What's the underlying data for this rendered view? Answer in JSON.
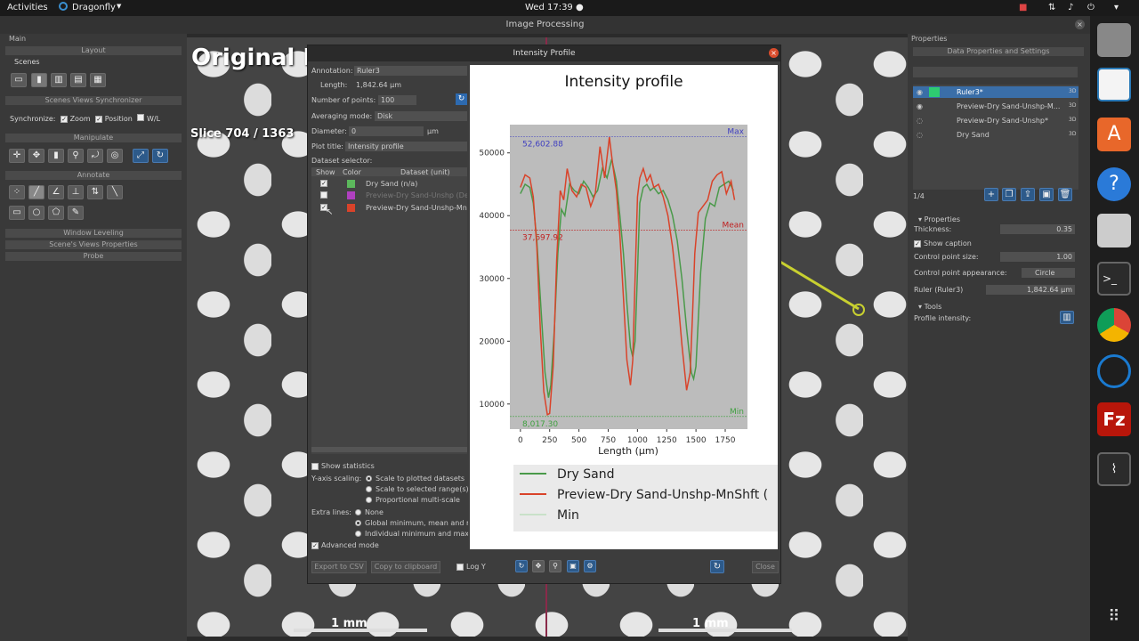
{
  "topbar": {
    "activities": "Activities",
    "app": "Dragonfly",
    "clock": "Wed 17:39 ●"
  },
  "window": {
    "title": "Image Processing"
  },
  "left_panel": {
    "main": "Main",
    "sections": [
      "Layout",
      "Scenes Views Synchronizer",
      "Manipulate",
      "Annotate",
      "Window Leveling",
      "Scene's Views Properties",
      "Probe"
    ],
    "scenes": "Scenes",
    "sync_label": "Synchronize:",
    "sync_zoom": "Zoom",
    "sync_position": "Position",
    "sync_wl": "W/L"
  },
  "viewer": {
    "title": "Original D",
    "slice": "Slice 704 / 1363",
    "scalebar_left": "1 mm",
    "scalebar_right": "1 mm"
  },
  "dialog": {
    "title": "Intensity Profile",
    "annotation_label": "Annotation:",
    "annotation_value": "Ruler3",
    "length_label": "Length:",
    "length_value": "1,842.64 µm",
    "points_label": "Number of points:",
    "points_value": "100",
    "averaging_label": "Averaging mode:",
    "averaging_value": "Disk",
    "diameter_label": "Diameter:",
    "diameter_value": "0",
    "diameter_unit": "µm",
    "plot_title_label": "Plot title:",
    "plot_title_value": "Intensity profile",
    "dataset_selector": "Dataset selector:",
    "table_headers": [
      "Show",
      "Color",
      "Dataset (unit)"
    ],
    "datasets": [
      {
        "name": "Dry Sand (n/a)",
        "color": "#5cb85c",
        "checked": true
      },
      {
        "name": "Preview-Dry Sand-Unshp (De",
        "color": "#b040c0",
        "checked": false
      },
      {
        "name": "Preview-Dry Sand-Unshp-MnS",
        "color": "#d9432a",
        "checked": true
      }
    ],
    "show_statistics": "Show statistics",
    "y_axis_label": "Y-axis scaling:",
    "y_axis_options": [
      "Scale to plotted datasets",
      "Scale to selected range(s)",
      "Proportional multi-scale"
    ],
    "extra_lines_label": "Extra lines:",
    "extra_lines_options": [
      "None",
      "Global minimum, mean and r",
      "Individual minimum and max"
    ],
    "advanced_mode": "Advanced mode",
    "export_csv": "Export to CSV",
    "copy_clipboard": "Copy to clipboard",
    "log_y": "Log Y",
    "close": "Close"
  },
  "chart_data": {
    "type": "line",
    "title": "Intensity profile",
    "xlabel": "Length (µm)",
    "ylabel": "",
    "xlim": [
      -90,
      1940
    ],
    "ylim": [
      6000,
      54500
    ],
    "xticks": [
      0,
      250,
      500,
      750,
      1000,
      1250,
      1500,
      1750
    ],
    "yticks": [
      10000,
      20000,
      30000,
      40000,
      50000
    ],
    "grid": false,
    "legend_placement": "bottom",
    "series": [
      {
        "name": "Dry Sand",
        "color": "#4a9a4a",
        "x": [
          0,
          40,
          80,
          110,
          140,
          180,
          210,
          240,
          260,
          290,
          320,
          350,
          380,
          420,
          460,
          500,
          540,
          580,
          620,
          660,
          700,
          740,
          780,
          820,
          850,
          880,
          910,
          940,
          960,
          980,
          1000,
          1020,
          1050,
          1080,
          1110,
          1140,
          1180,
          1220,
          1260,
          1300,
          1340,
          1380,
          1420,
          1460,
          1480,
          1500,
          1540,
          1580,
          1620,
          1660,
          1700,
          1740,
          1780,
          1820
        ],
        "y": [
          43500,
          45000,
          44500,
          42000,
          36000,
          24000,
          15000,
          11000,
          13000,
          22000,
          34000,
          41000,
          40000,
          45000,
          44000,
          43500,
          45500,
          44500,
          43000,
          44000,
          47500,
          46000,
          49000,
          45500,
          40000,
          34000,
          26000,
          19000,
          17500,
          20000,
          31000,
          42000,
          44500,
          45000,
          44000,
          44500,
          43500,
          44000,
          42500,
          40000,
          36000,
          30000,
          22000,
          15000,
          14000,
          16000,
          31000,
          39500,
          42000,
          41500,
          44500,
          45000,
          45500,
          44000
        ]
      },
      {
        "name": "Preview-Dry Sand-Unshp-MnShft (",
        "color": "#d9432a",
        "x": [
          0,
          40,
          80,
          110,
          140,
          170,
          200,
          230,
          250,
          280,
          310,
          340,
          370,
          400,
          440,
          480,
          520,
          560,
          600,
          640,
          680,
          720,
          760,
          790,
          820,
          850,
          880,
          910,
          940,
          960,
          980,
          1000,
          1020,
          1050,
          1080,
          1110,
          1140,
          1180,
          1220,
          1260,
          1300,
          1340,
          1380,
          1420,
          1450,
          1470,
          1490,
          1520,
          1560,
          1600,
          1640,
          1680,
          1720,
          1760,
          1800,
          1830
        ],
        "y": [
          44500,
          46500,
          46000,
          43000,
          35000,
          22000,
          12000,
          8300,
          8500,
          16000,
          33000,
          44000,
          42500,
          47500,
          44000,
          43000,
          45000,
          44500,
          41500,
          43500,
          51000,
          46000,
          52500,
          48000,
          44000,
          37000,
          27000,
          17000,
          13000,
          17000,
          30000,
          43000,
          46000,
          47500,
          45500,
          46500,
          44500,
          45000,
          43000,
          40000,
          35000,
          28000,
          19500,
          12200,
          15000,
          24000,
          34000,
          40500,
          41500,
          42500,
          45500,
          46500,
          47000,
          43500,
          45500,
          42500
        ]
      },
      {
        "name": "Min",
        "color": "#a8d8a8",
        "style": "thin"
      }
    ],
    "hlines": [
      {
        "label": "Max",
        "value_label": "52,602.88",
        "y": 52602.88,
        "color": "#4040c0"
      },
      {
        "label": "Mean",
        "value_label": "37,697.92",
        "y": 37697.92,
        "color": "#c02020"
      },
      {
        "label": "Min",
        "value_label": "8,017.30",
        "y": 8017.3,
        "color": "#40a040"
      }
    ]
  },
  "right_panel": {
    "title": "Properties",
    "subtitle": "Data Properties and Settings",
    "datasets": [
      {
        "name": "Ruler3*",
        "tag": "3D",
        "selected": true
      },
      {
        "name": "Preview-Dry Sand-Unshp-M...",
        "tag": "3D",
        "selected": false
      },
      {
        "name": "Preview-Dry Sand-Unshp*",
        "tag": "3D",
        "selected": false
      },
      {
        "name": "Dry Sand",
        "tag": "3D",
        "selected": false
      }
    ],
    "count": "1/4",
    "properties_header": "Properties",
    "thickness_label": "Thickness:",
    "thickness_value": "0.35",
    "show_caption": "Show caption",
    "cp_size_label": "Control point size:",
    "cp_size_value": "1.00",
    "cp_appearance_label": "Control point appearance:",
    "cp_appearance_value": "Circle",
    "ruler_label": "Ruler (Ruler3)",
    "ruler_value": "1,842.64 µm",
    "tools_header": "Tools",
    "profile_label": "Profile intensity:"
  }
}
